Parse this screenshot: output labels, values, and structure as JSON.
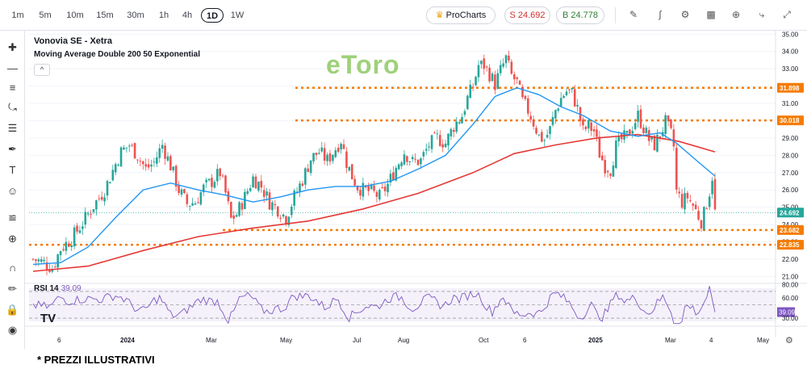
{
  "toolbar": {
    "timeframes": [
      "1m",
      "5m",
      "10m",
      "15m",
      "30m",
      "1h",
      "4h",
      "1D",
      "1W"
    ],
    "active_timeframe": "1D",
    "prochart_label": "ProCharts",
    "sell_label": "S 24.692",
    "buy_label": "B 24.778",
    "sell_color": "#d32f2f",
    "buy_color": "#2e7d32",
    "icons": [
      "pencil-icon",
      "indicators-icon",
      "settings-icon",
      "chart-type-icon",
      "add-icon",
      "share-icon",
      "collapse-icon"
    ]
  },
  "sidebar": {
    "icons": [
      "crosshair-icon",
      "trend-line-icon",
      "horizontal-lines-icon",
      "pattern-icon",
      "fib-icon",
      "brush-icon",
      "text-icon",
      "emoji-icon",
      "ruler-icon",
      "zoom-icon",
      "magnet-icon",
      "lock-drawing-icon",
      "lock-icon",
      "eye-icon"
    ]
  },
  "legend": {
    "title": "Vonovia SE - Xetra",
    "ma": "Moving Average Double 200 50 Exponential",
    "collapse": "^"
  },
  "watermark": "eToro",
  "rsi": {
    "name": "RSI 14",
    "value": "39.09"
  },
  "tv_logo": "TV",
  "footnote": "* PREZZI ILLUSTRATIVI",
  "chart_data": {
    "type": "candlestick",
    "symbol": "Vonovia SE - Xetra",
    "timeframe": "1D",
    "colors": {
      "up": "#26a69a",
      "down": "#ef5350",
      "ema50": "#2196f3",
      "ema200": "#e53935",
      "levels": "#f57c00",
      "rsi": "#7e57c2"
    },
    "y_axis_ticks": [
      35.0,
      34.0,
      33.0,
      32.0,
      31.0,
      30.0,
      29.0,
      28.0,
      27.0,
      26.0,
      25.0,
      24.0,
      23.0,
      22.0,
      21.0
    ],
    "ylim": [
      20.6,
      35.2
    ],
    "x_axis_labels": [
      "6",
      "2024",
      "Mar",
      "May",
      "Jul",
      "Aug",
      "Oct",
      "6",
      "2025",
      "Mar",
      "4",
      "May"
    ],
    "price_levels": [
      31.898,
      30.018,
      23.682,
      22.835
    ],
    "current_price": 24.692,
    "close_path": [
      [
        0,
        22.0
      ],
      [
        4,
        21.8
      ],
      [
        7,
        21.5
      ],
      [
        10,
        22.6
      ],
      [
        14,
        23.2
      ],
      [
        18,
        24.1
      ],
      [
        22,
        25.1
      ],
      [
        26,
        26.0
      ],
      [
        30,
        27.5
      ],
      [
        32,
        28.2
      ],
      [
        35,
        28.6
      ],
      [
        38,
        28.0
      ],
      [
        41,
        27.2
      ],
      [
        44,
        27.6
      ],
      [
        47,
        28.6
      ],
      [
        50,
        27.4
      ],
      [
        53,
        26.0
      ],
      [
        56,
        25.2
      ],
      [
        59,
        25.3
      ],
      [
        62,
        26.1
      ],
      [
        65,
        26.5
      ],
      [
        68,
        27.0
      ],
      [
        70,
        25.8
      ],
      [
        72,
        24.3
      ],
      [
        74,
        24.6
      ],
      [
        77,
        25.6
      ],
      [
        80,
        26.7
      ],
      [
        83,
        26.2
      ],
      [
        86,
        25.3
      ],
      [
        89,
        24.9
      ],
      [
        92,
        24.4
      ],
      [
        95,
        25.6
      ],
      [
        98,
        26.6
      ],
      [
        101,
        27.8
      ],
      [
        104,
        28.2
      ],
      [
        107,
        27.7
      ],
      [
        110,
        28.4
      ],
      [
        112,
        28.9
      ],
      [
        114,
        27.6
      ],
      [
        116,
        26.8
      ],
      [
        118,
        26.2
      ],
      [
        120,
        26.0
      ],
      [
        123,
        25.9
      ],
      [
        126,
        25.6
      ],
      [
        129,
        26.3
      ],
      [
        132,
        27.3
      ],
      [
        135,
        28.2
      ],
      [
        138,
        27.6
      ],
      [
        141,
        27.7
      ],
      [
        144,
        28.6
      ],
      [
        147,
        29.0
      ],
      [
        150,
        28.7
      ],
      [
        153,
        29.7
      ],
      [
        156,
        30.3
      ],
      [
        158,
        31.3
      ],
      [
        160,
        32.0
      ],
      [
        162,
        33.2
      ],
      [
        164,
        33.2
      ],
      [
        166,
        32.7
      ],
      [
        168,
        32.1
      ],
      [
        170,
        32.9
      ],
      [
        172,
        33.6
      ],
      [
        174,
        32.6
      ],
      [
        176,
        32.2
      ],
      [
        178,
        31.1
      ],
      [
        180,
        30.6
      ],
      [
        182,
        29.9
      ],
      [
        184,
        29.1
      ],
      [
        186,
        28.9
      ],
      [
        188,
        29.5
      ],
      [
        190,
        30.6
      ],
      [
        192,
        31.3
      ],
      [
        194,
        31.7
      ],
      [
        196,
        31.6
      ],
      [
        198,
        30.7
      ],
      [
        200,
        29.4
      ],
      [
        202,
        29.7
      ],
      [
        204,
        29.4
      ],
      [
        206,
        28.1
      ],
      [
        208,
        27.4
      ],
      [
        210,
        27.2
      ],
      [
        212,
        28.5
      ],
      [
        214,
        28.9
      ],
      [
        216,
        29.1
      ],
      [
        218,
        29.7
      ],
      [
        220,
        30.3
      ],
      [
        222,
        29.6
      ],
      [
        224,
        28.9
      ],
      [
        226,
        28.6
      ],
      [
        228,
        29.2
      ],
      [
        230,
        29.9
      ],
      [
        232,
        29.2
      ],
      [
        233,
        28.5
      ],
      [
        234,
        25.9
      ],
      [
        236,
        25.3
      ],
      [
        238,
        25.6
      ],
      [
        240,
        25.1
      ],
      [
        242,
        24.5
      ],
      [
        243,
        24.2
      ],
      [
        244,
        24.6
      ],
      [
        246,
        25.9
      ],
      [
        247,
        26.8
      ],
      [
        248,
        24.7
      ]
    ],
    "ema50_path": [
      [
        0,
        21.7
      ],
      [
        10,
        21.8
      ],
      [
        20,
        22.7
      ],
      [
        30,
        24.4
      ],
      [
        40,
        26.0
      ],
      [
        50,
        26.4
      ],
      [
        60,
        26.0
      ],
      [
        70,
        25.7
      ],
      [
        80,
        25.3
      ],
      [
        90,
        25.6
      ],
      [
        100,
        26.0
      ],
      [
        110,
        26.2
      ],
      [
        120,
        26.2
      ],
      [
        130,
        26.5
      ],
      [
        140,
        27.2
      ],
      [
        150,
        28.0
      ],
      [
        160,
        29.8
      ],
      [
        168,
        31.4
      ],
      [
        176,
        31.9
      ],
      [
        184,
        31.5
      ],
      [
        192,
        30.8
      ],
      [
        200,
        30.3
      ],
      [
        210,
        29.4
      ],
      [
        220,
        29.1
      ],
      [
        228,
        29.3
      ],
      [
        234,
        28.7
      ],
      [
        242,
        27.6
      ],
      [
        248,
        26.8
      ]
    ],
    "ema200_path": [
      [
        0,
        21.3
      ],
      [
        20,
        21.6
      ],
      [
        40,
        22.5
      ],
      [
        60,
        23.3
      ],
      [
        80,
        23.8
      ],
      [
        100,
        24.2
      ],
      [
        120,
        24.9
      ],
      [
        140,
        25.8
      ],
      [
        160,
        27.0
      ],
      [
        175,
        28.1
      ],
      [
        190,
        28.6
      ],
      [
        205,
        29.0
      ],
      [
        220,
        29.2
      ],
      [
        235,
        28.8
      ],
      [
        248,
        28.2
      ]
    ],
    "n_bars": 249,
    "rsi_levels": [
      80.0,
      60.0,
      39.09,
      30.0
    ],
    "rsi_lines": [
      70,
      50,
      30
    ],
    "rsi_ylim": [
      18,
      82
    ]
  }
}
